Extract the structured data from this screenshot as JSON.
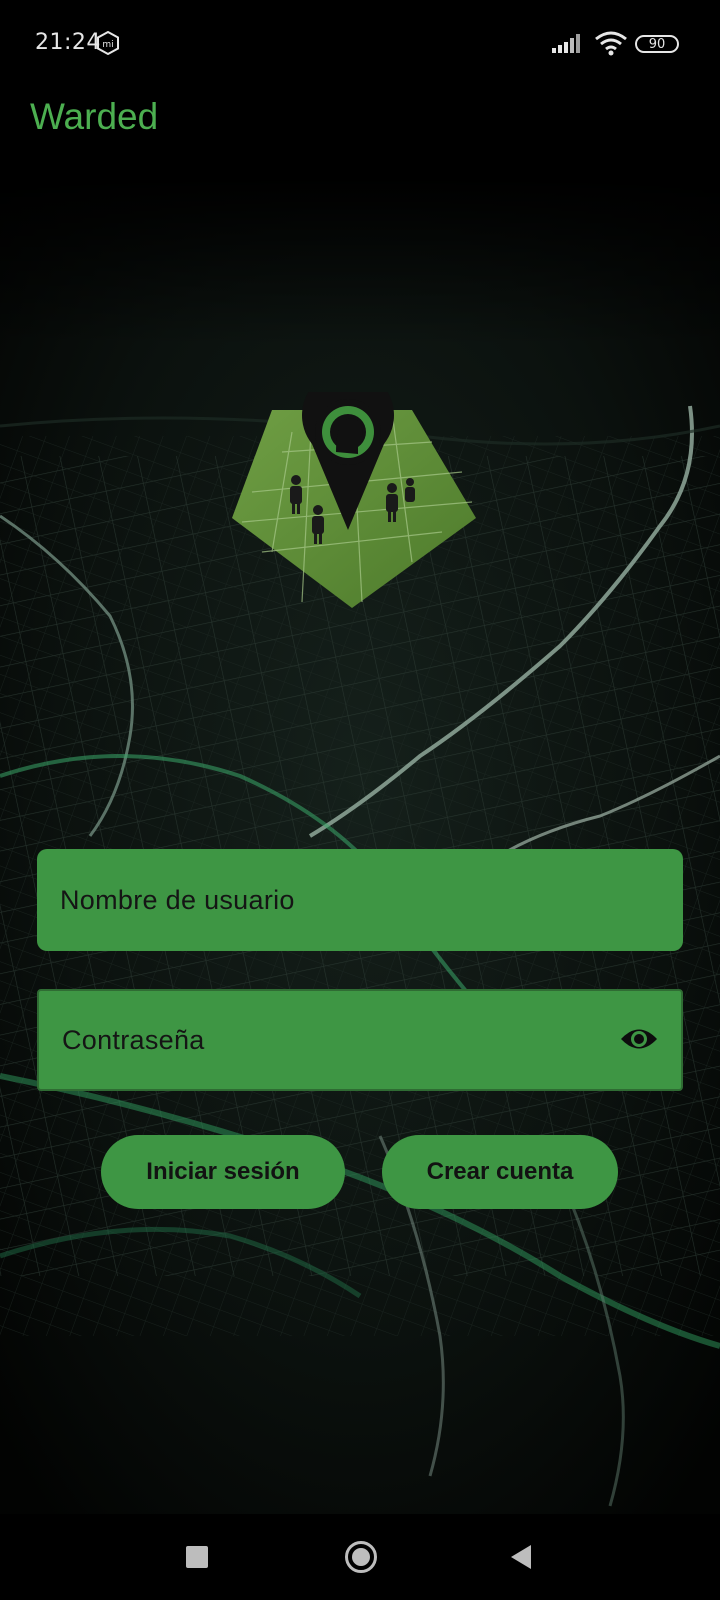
{
  "status_bar": {
    "time": "21:24",
    "battery": "90",
    "icons": [
      "mi-icon",
      "signal-icon",
      "wifi-icon",
      "battery-icon"
    ]
  },
  "app_bar": {
    "title": "Warded"
  },
  "login_form": {
    "username_placeholder": "Nombre de usuario",
    "password_placeholder": "Contraseña",
    "password_toggle_icon": "eye-icon"
  },
  "actions": {
    "login_label": "Iniciar sesión",
    "create_account_label": "Crear cuenta"
  },
  "navigation_bar": {
    "icons": [
      "recent-apps-icon",
      "home-icon",
      "back-icon"
    ]
  },
  "colors": {
    "accent": "#4caf50",
    "field_bg": "#3e9644",
    "background": "#000000"
  }
}
